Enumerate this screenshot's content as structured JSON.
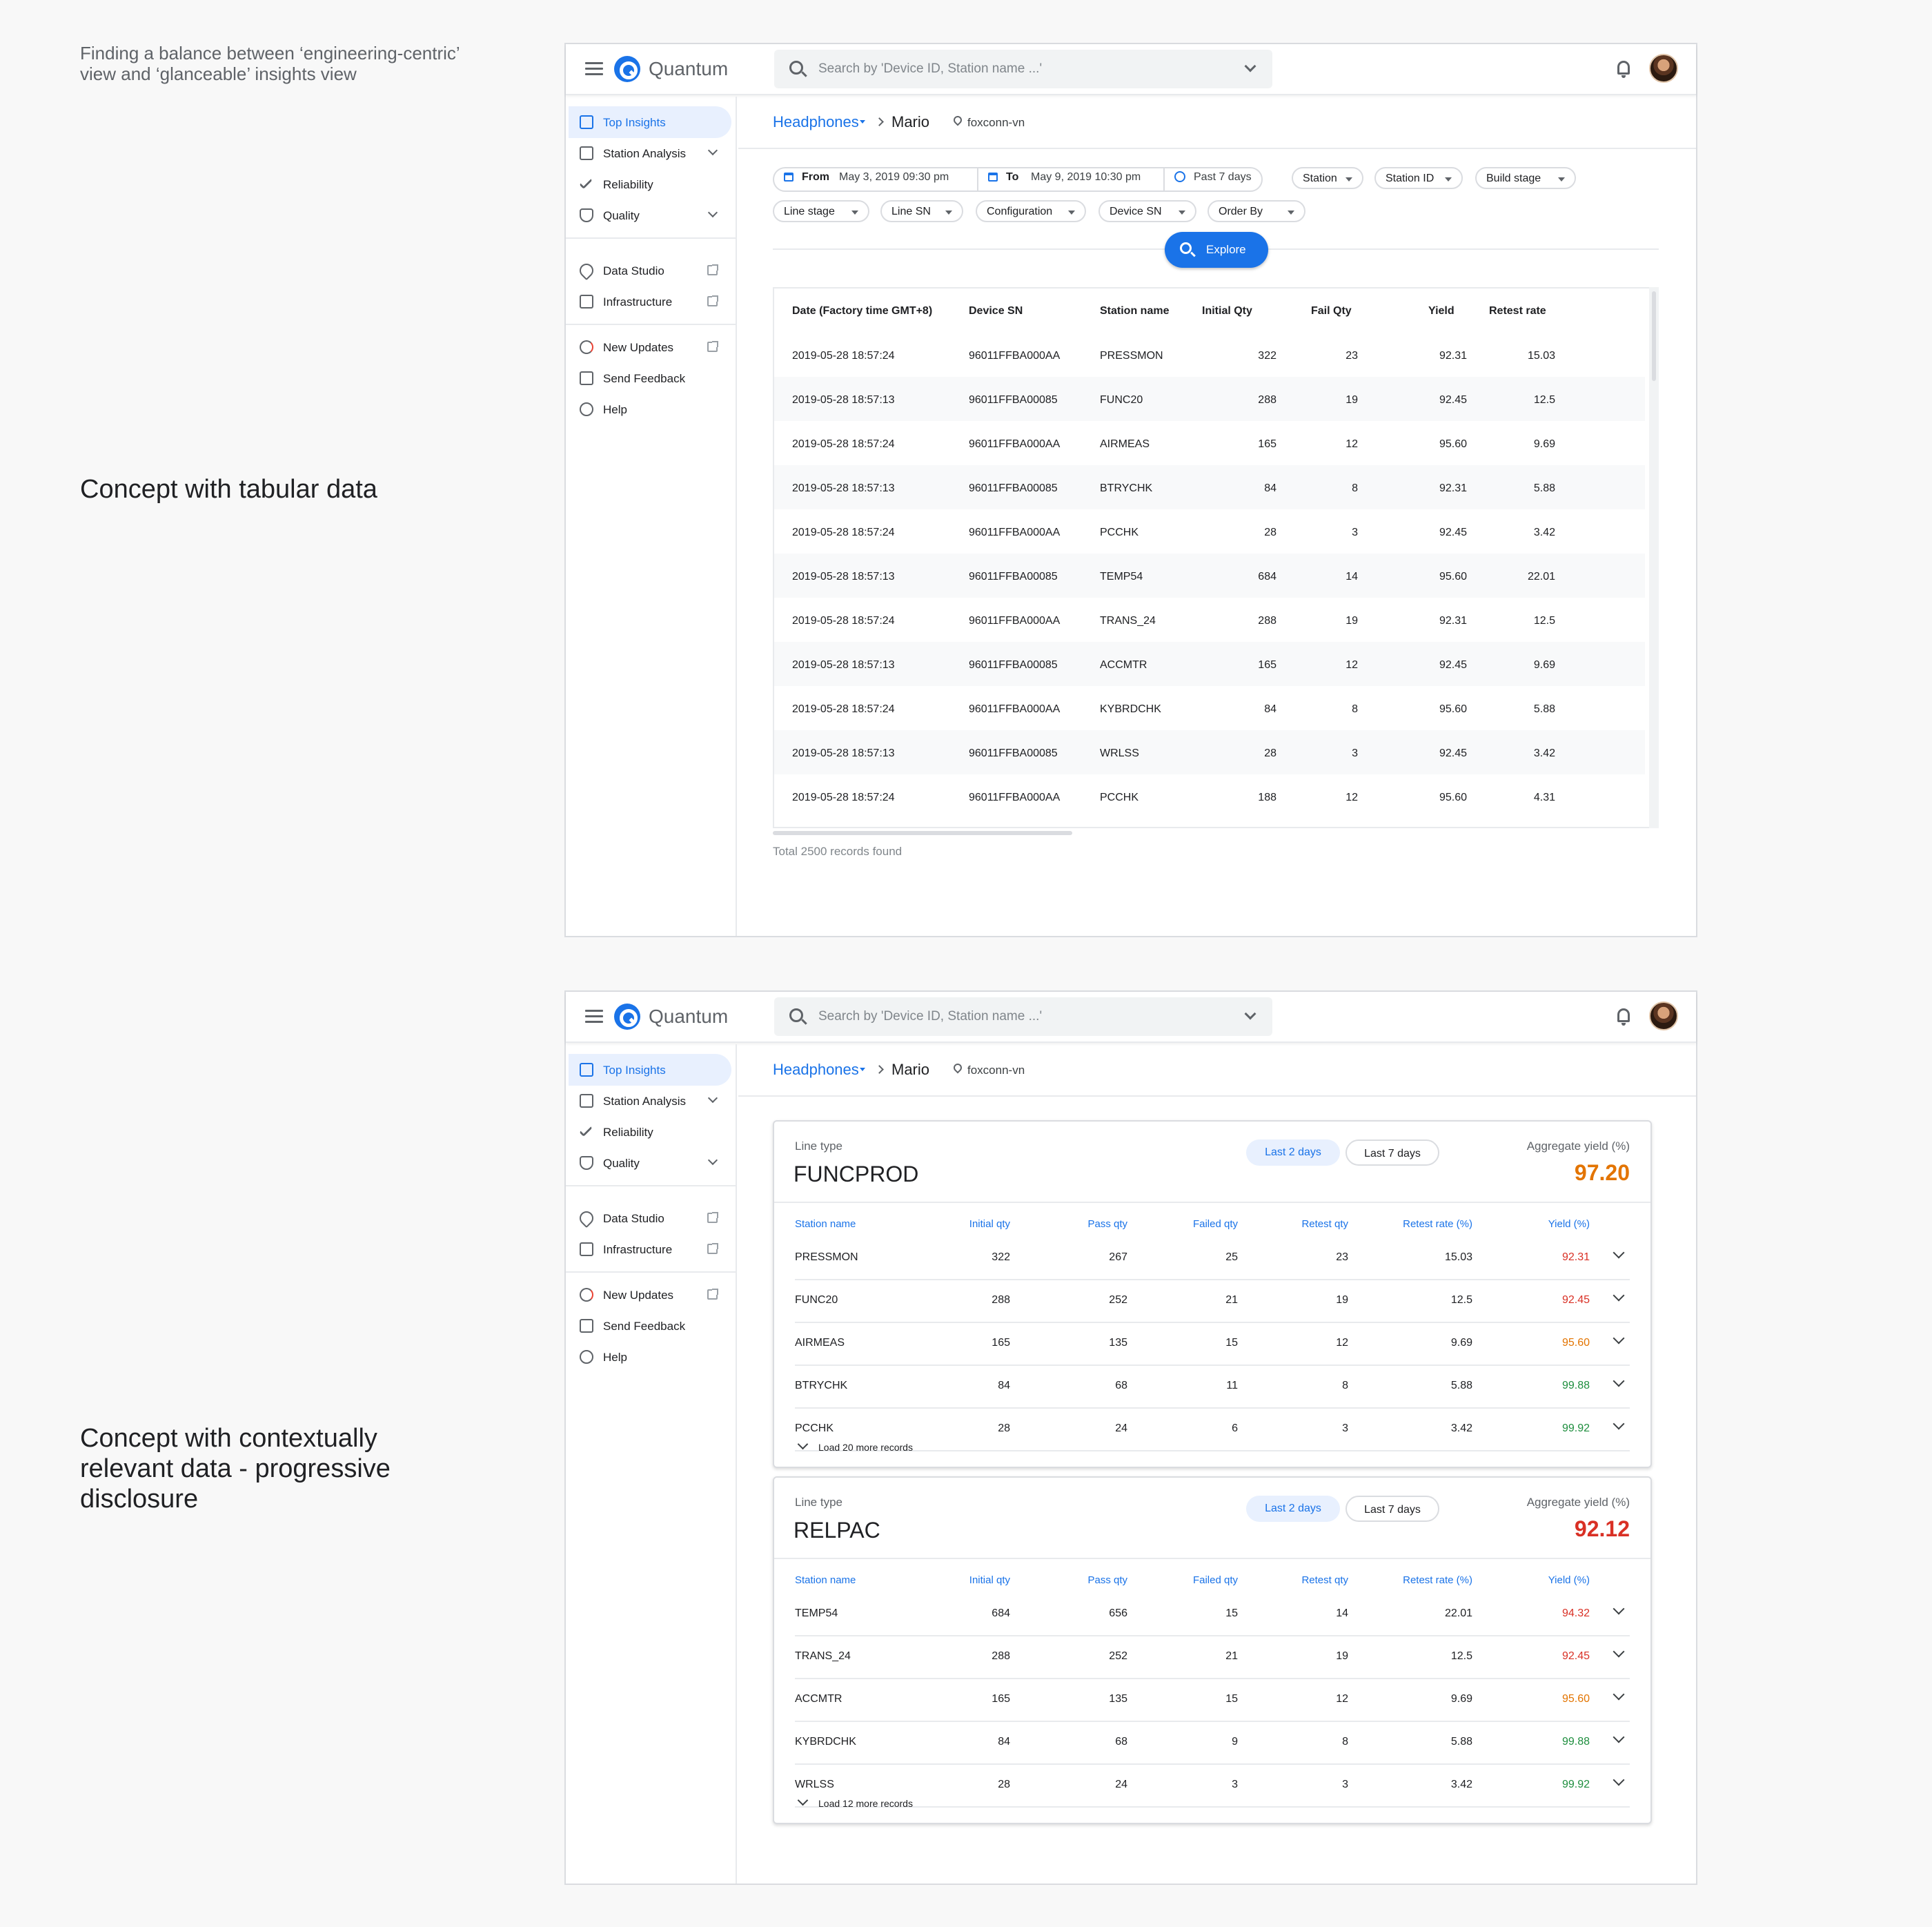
{
  "notes": {
    "top": "Finding a balance between ‘engineering-centric’ view and ‘glanceable’ insights view",
    "tabular": "Concept with tabular data",
    "contextual": "Concept with contextually relevant data - progressive disclosure"
  },
  "app": {
    "brand": "Quantum",
    "search_placeholder": "Search by 'Device ID, Station name ...'"
  },
  "sidebar": {
    "items": [
      {
        "label": "Top Insights",
        "icon": "dashboard-icon"
      },
      {
        "label": "Station Analysis",
        "icon": "bar-chart-icon"
      },
      {
        "label": "Reliability",
        "icon": "double-check-icon"
      },
      {
        "label": "Quality",
        "icon": "shield-icon"
      },
      {
        "label": "Data Studio",
        "icon": "wrench-icon"
      },
      {
        "label": "Infrastructure",
        "icon": "server-icon"
      },
      {
        "label": "New Updates",
        "icon": "sync-icon"
      },
      {
        "label": "Send Feedback",
        "icon": "feedback-icon"
      },
      {
        "label": "Help",
        "icon": "help-icon"
      }
    ]
  },
  "breadcrumb": {
    "product": "Headphones",
    "project": "Mario",
    "location": "foxconn-vn"
  },
  "filters": {
    "from_label": "From",
    "from_value": "May 3, 2019    09:30 pm",
    "to_label": "To",
    "to_value": "May 9, 2019    10:30 pm",
    "range": "Past 7 days",
    "chips": [
      "Station",
      "Station ID",
      "Build stage",
      "Line stage",
      "Line SN",
      "Configuration",
      "Device SN",
      "Order By"
    ],
    "explore_label": "Explore"
  },
  "table": {
    "columns": [
      "Date (Factory time GMT+8)",
      "Device SN",
      "Station name",
      "Initial Qty",
      "Fail Qty",
      "Yield",
      "Retest rate"
    ],
    "rows": [
      [
        "2019-05-28   18:57:24",
        "96011FFBA000AA",
        "PRESSMON",
        "322",
        "23",
        "92.31",
        "15.03"
      ],
      [
        "2019-05-28   18:57:13",
        "96011FFBA00085",
        "FUNC20",
        "288",
        "19",
        "92.45",
        "12.5"
      ],
      [
        "2019-05-28   18:57:24",
        "96011FFBA000AA",
        "AIRMEAS",
        "165",
        "12",
        "95.60",
        "9.69"
      ],
      [
        "2019-05-28   18:57:13",
        "96011FFBA00085",
        "BTRYCHK",
        "84",
        "8",
        "92.31",
        "5.88"
      ],
      [
        "2019-05-28   18:57:24",
        "96011FFBA000AA",
        "PCCHK",
        "28",
        "3",
        "92.45",
        "3.42"
      ],
      [
        "2019-05-28   18:57:13",
        "96011FFBA00085",
        "TEMP54",
        "684",
        "14",
        "95.60",
        "22.01"
      ],
      [
        "2019-05-28   18:57:24",
        "96011FFBA000AA",
        "TRANS_24",
        "288",
        "19",
        "92.31",
        "12.5"
      ],
      [
        "2019-05-28   18:57:13",
        "96011FFBA00085",
        "ACCMTR",
        "165",
        "12",
        "92.45",
        "9.69"
      ],
      [
        "2019-05-28   18:57:24",
        "96011FFBA000AA",
        "KYBRDCHK",
        "84",
        "8",
        "95.60",
        "5.88"
      ],
      [
        "2019-05-28   18:57:13",
        "96011FFBA00085",
        "WRLSS",
        "28",
        "3",
        "92.45",
        "3.42"
      ],
      [
        "2019-05-28   18:57:24",
        "96011FFBA000AA",
        "PCCHK",
        "188",
        "12",
        "95.60",
        "4.31"
      ]
    ],
    "total": "Total 2500 records found"
  },
  "cards": [
    {
      "line_type_label": "Line type",
      "line_type": "FUNCPROD",
      "toggle_on": "Last 2 days",
      "toggle_off": "Last 7 days",
      "agg_label": "Aggregate yield (%)",
      "agg_value": "97.20",
      "agg_color": "#e37400",
      "columns": [
        "Station name",
        "Initial qty",
        "Pass qty",
        "Failed qty",
        "Retest qty",
        "Retest rate (%)",
        "Yield (%)"
      ],
      "rows": [
        {
          "cells": [
            "PRESSMON",
            "322",
            "267",
            "25",
            "23",
            "15.03",
            "92.31"
          ],
          "color": "#d93025"
        },
        {
          "cells": [
            "FUNC20",
            "288",
            "252",
            "21",
            "19",
            "12.5",
            "92.45"
          ],
          "color": "#d93025"
        },
        {
          "cells": [
            "AIRMEAS",
            "165",
            "135",
            "15",
            "12",
            "9.69",
            "95.60"
          ],
          "color": "#e37400"
        },
        {
          "cells": [
            "BTRYCHK",
            "84",
            "68",
            "11",
            "8",
            "5.88",
            "99.88"
          ],
          "color": "#1e8e3e"
        },
        {
          "cells": [
            "PCCHK",
            "28",
            "24",
            "6",
            "3",
            "3.42",
            "99.92"
          ],
          "color": "#1e8e3e"
        }
      ],
      "load_more": "Load 20 more records"
    },
    {
      "line_type_label": "Line type",
      "line_type": "RELPAC",
      "toggle_on": "Last 2 days",
      "toggle_off": "Last 7 days",
      "agg_label": "Aggregate yield (%)",
      "agg_value": "92.12",
      "agg_color": "#d93025",
      "columns": [
        "Station name",
        "Initial qty",
        "Pass qty",
        "Failed qty",
        "Retest qty",
        "Retest rate (%)",
        "Yield (%)"
      ],
      "rows": [
        {
          "cells": [
            "TEMP54",
            "684",
            "656",
            "15",
            "14",
            "22.01",
            "94.32"
          ],
          "color": "#d93025"
        },
        {
          "cells": [
            "TRANS_24",
            "288",
            "252",
            "21",
            "19",
            "12.5",
            "92.45"
          ],
          "color": "#d93025"
        },
        {
          "cells": [
            "ACCMTR",
            "165",
            "135",
            "15",
            "12",
            "9.69",
            "95.60"
          ],
          "color": "#e37400"
        },
        {
          "cells": [
            "KYBRDCHK",
            "84",
            "68",
            "9",
            "8",
            "5.88",
            "99.88"
          ],
          "color": "#1e8e3e"
        },
        {
          "cells": [
            "WRLSS",
            "28",
            "24",
            "3",
            "3",
            "3.42",
            "99.92"
          ],
          "color": "#1e8e3e"
        }
      ],
      "load_more": "Load 12 more records"
    }
  ]
}
